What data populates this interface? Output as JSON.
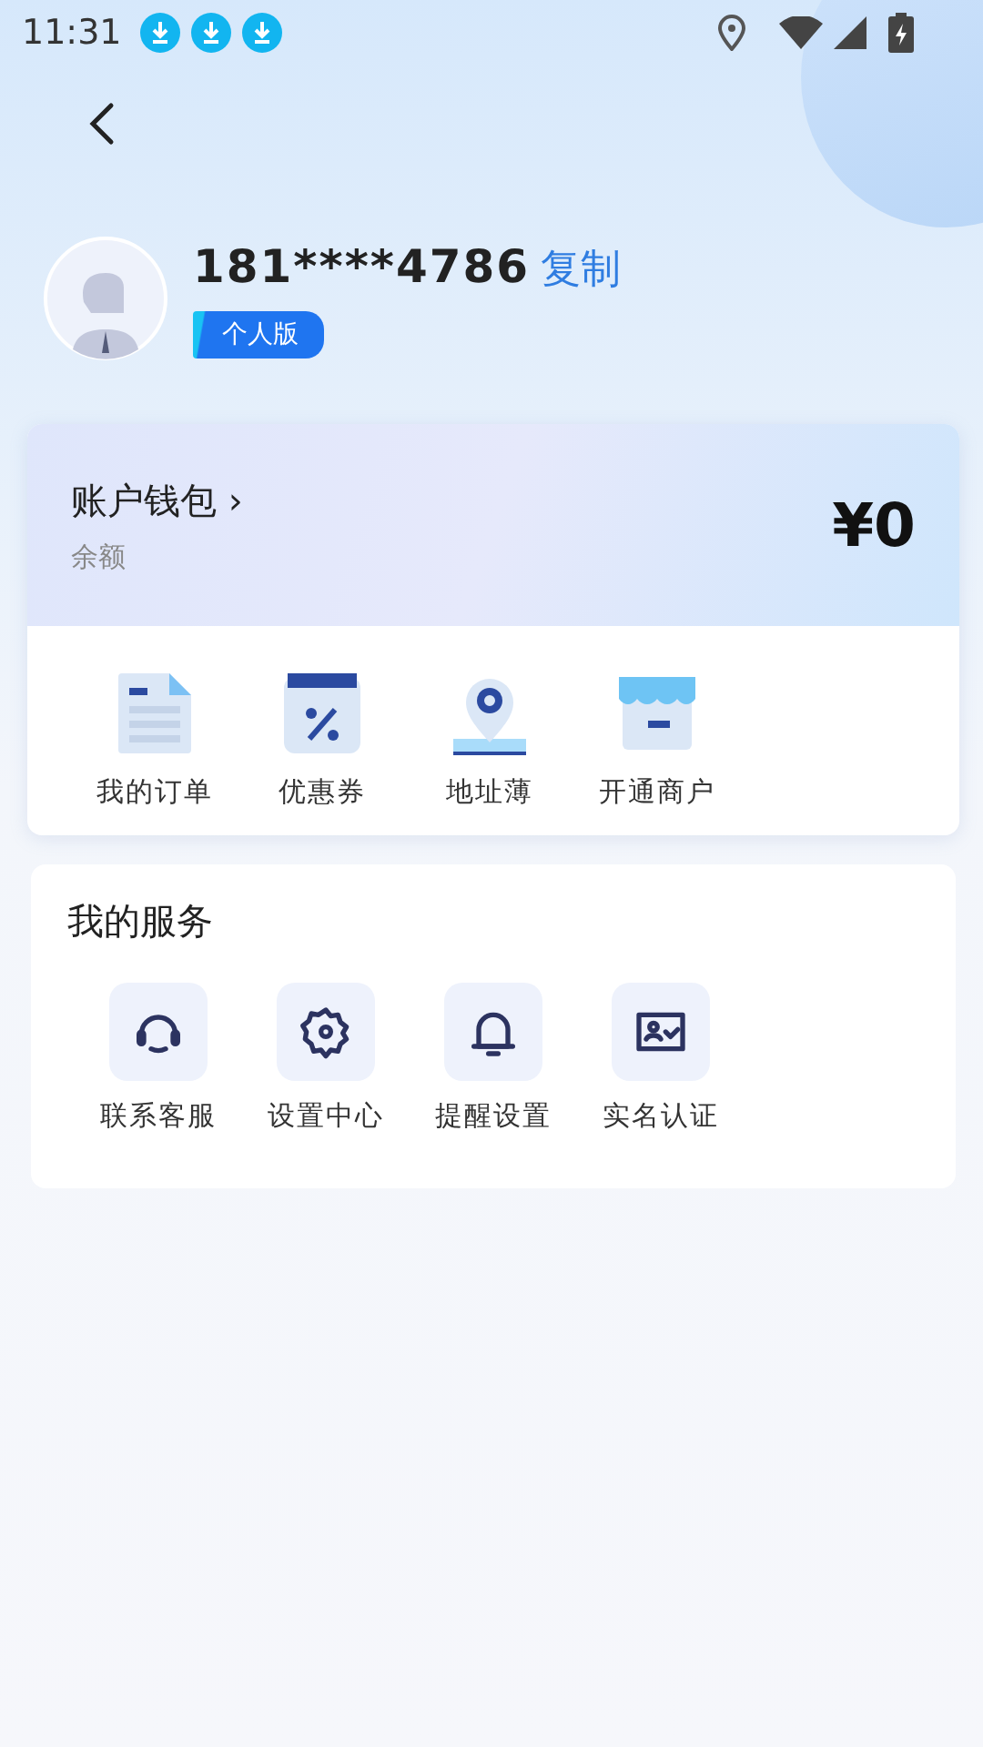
{
  "status_bar": {
    "time": "11:31"
  },
  "profile": {
    "phone": "181****4786",
    "copy_link": "复制",
    "badge": "个人版"
  },
  "wallet": {
    "title": "账户钱包",
    "chevron": "›",
    "subtitle": "余额",
    "amount": "¥0",
    "shortcuts": [
      {
        "label": "我的订单"
      },
      {
        "label": "优惠券"
      },
      {
        "label": "地址薄"
      },
      {
        "label": "开通商户"
      }
    ]
  },
  "services": {
    "title": "我的服务",
    "items": [
      {
        "label": "联系客服"
      },
      {
        "label": "设置中心"
      },
      {
        "label": "提醒设置"
      },
      {
        "label": "实名认证"
      }
    ]
  }
}
